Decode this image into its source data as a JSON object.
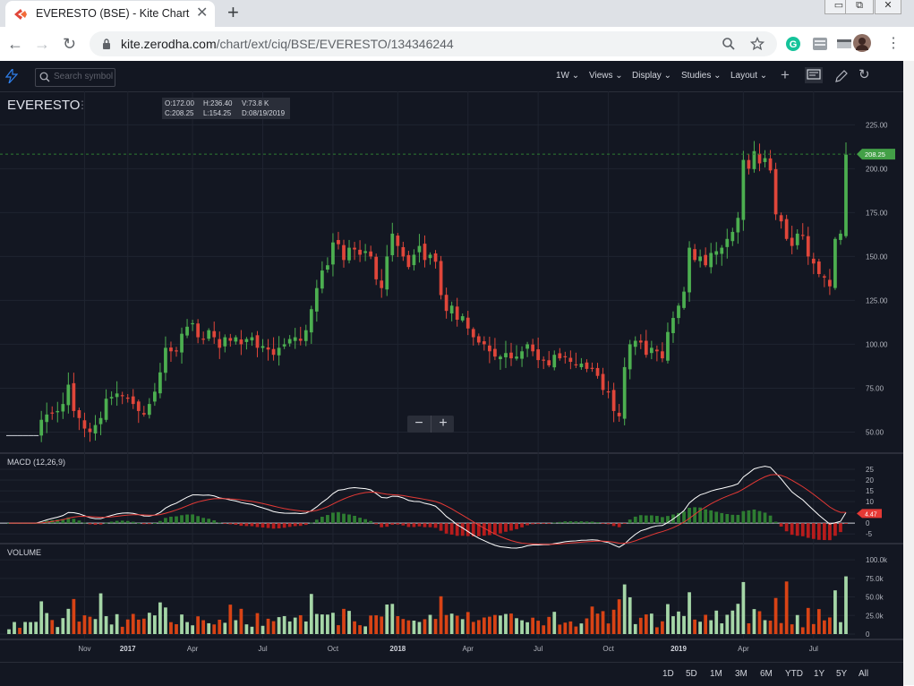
{
  "browser": {
    "tab_title": "EVERESTO (BSE) - Kite Chart",
    "tab_close": "✕",
    "new_tab": "+",
    "url_host": "kite.zerodha.com",
    "url_path": "/chart/ext/ciq/BSE/EVERESTO/134346244",
    "window_buttons": [
      "▭",
      "⧉",
      "✕"
    ]
  },
  "toolbar": {
    "search_placeholder": "Search symbol",
    "interval": "1W",
    "menus": [
      "Views",
      "Display",
      "Studies",
      "Layout"
    ]
  },
  "symbol": "EVERESTO",
  "ohlc": {
    "open": "O:172.00",
    "high": "H:236.40",
    "volume": "V:73.8 K",
    "close": "C:208.25",
    "low": "L:154.25",
    "date": "D:08/19/2019"
  },
  "zoom": {
    "minus": "−",
    "plus": "+"
  },
  "ranges": [
    "1D",
    "5D",
    "1M",
    "3M",
    "6M",
    "YTD",
    "1Y",
    "5Y",
    "All"
  ],
  "colors": {
    "background": "#131722",
    "up": "#4caf50",
    "down": "#e0463a",
    "macd_line": "#ffffff",
    "signal_line": "#e53935",
    "price_badge": "#43a047",
    "macd_badge": "#e53935"
  },
  "chart_data": {
    "type": "candlestick",
    "last_price": "208.25",
    "price_axis": {
      "ticks": [
        "225.00",
        "200.00",
        "175.00",
        "150.00",
        "125.00",
        "100.00",
        "75.00",
        "50.00"
      ],
      "ylim": [
        38,
        242
      ]
    },
    "time_axis": {
      "labels": [
        "Nov",
        "2017",
        "Apr",
        "Jul",
        "Oct",
        "2018",
        "Apr",
        "Jul",
        "Oct",
        "2019",
        "Apr",
        "Jul"
      ]
    },
    "weekly_closes": [
      48,
      48,
      48,
      48,
      48,
      48,
      57,
      60,
      61,
      62,
      66,
      77,
      62,
      58,
      52,
      50,
      54,
      58,
      69,
      70,
      72,
      71,
      69,
      66,
      62,
      60,
      66,
      73,
      84,
      98,
      96,
      96,
      106,
      110,
      112,
      104,
      103,
      108,
      104,
      98,
      104,
      102,
      104,
      100,
      103,
      104,
      98,
      99,
      97,
      94,
      98,
      100,
      103,
      104,
      102,
      108,
      120,
      132,
      142,
      145,
      158,
      157,
      148,
      155,
      154,
      151,
      153,
      150,
      137,
      132,
      150,
      163,
      156,
      150,
      144,
      151,
      156,
      148,
      151,
      147,
      128,
      119,
      122,
      114,
      116,
      109,
      104,
      101,
      100,
      96,
      93,
      93,
      95,
      92,
      93,
      96,
      100,
      96,
      91,
      91,
      88,
      94,
      92,
      93,
      90,
      88,
      89,
      86,
      86,
      82,
      74,
      73,
      62,
      59,
      87,
      100,
      102,
      101,
      94,
      98,
      96,
      92,
      107,
      115,
      122,
      130,
      155,
      148,
      150,
      145,
      152,
      153,
      155,
      160,
      164,
      172,
      205,
      200,
      210,
      203,
      206,
      199,
      174,
      170,
      160,
      156,
      163,
      162,
      150,
      146,
      140,
      138,
      133,
      160,
      163,
      208
    ],
    "volume_axis": {
      "ticks": [
        "100.0k",
        "75.0k",
        "50.0k",
        "25.0k",
        "0"
      ],
      "ylim": [
        0,
        117000
      ]
    },
    "macd": {
      "name": "MACD (12,26,9)",
      "badge_value": "4.47",
      "ticks": [
        "25",
        "20",
        "15",
        "10",
        "5",
        "0",
        "-5"
      ],
      "ylim": [
        -7,
        30
      ]
    },
    "volume_name": "VOLUME"
  }
}
